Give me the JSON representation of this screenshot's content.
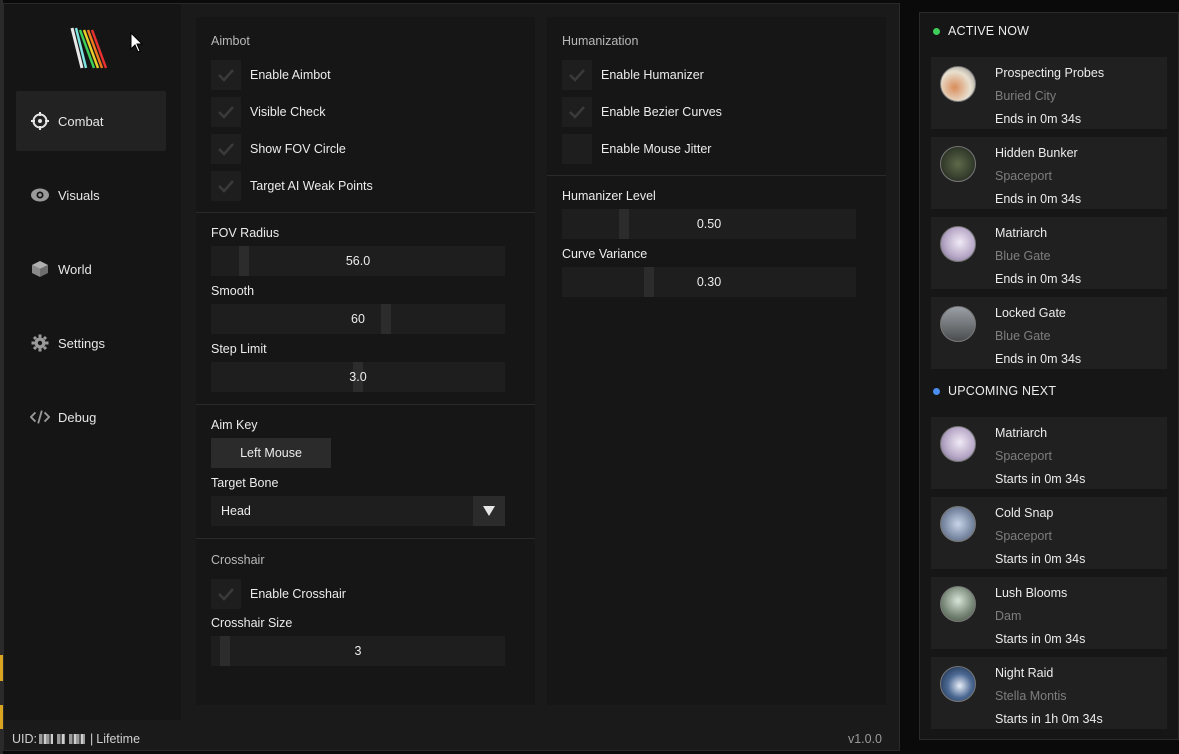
{
  "sidebar": {
    "items": [
      {
        "label": "Combat",
        "icon": "crosshair-icon",
        "active": true
      },
      {
        "label": "Visuals",
        "icon": "eye-icon",
        "active": false
      },
      {
        "label": "World",
        "icon": "cube-icon",
        "active": false
      },
      {
        "label": "Settings",
        "icon": "gear-icon",
        "active": false
      },
      {
        "label": "Debug",
        "icon": "code-icon",
        "active": false
      }
    ]
  },
  "aimbot": {
    "title": "Aimbot",
    "checks": [
      {
        "label": "Enable Aimbot",
        "checked": true
      },
      {
        "label": "Visible Check",
        "checked": true
      },
      {
        "label": "Show FOV Circle",
        "checked": true
      },
      {
        "label": "Target AI Weak Points",
        "checked": true
      }
    ],
    "sliders": [
      {
        "label": "FOV Radius",
        "value": "56.0",
        "level": 0.1
      },
      {
        "label": "Smooth",
        "value": "60",
        "level": 0.6
      },
      {
        "label": "Step Limit",
        "value": "3.0",
        "level": 0.5
      }
    ],
    "aim_key_label": "Aim Key",
    "aim_key_value": "Left Mouse",
    "target_bone_label": "Target Bone",
    "target_bone_value": "Head"
  },
  "crosshair": {
    "title": "Crosshair",
    "enable_label": "Enable Crosshair",
    "enabled": true,
    "size_label": "Crosshair Size",
    "size_value": "3",
    "size_level": 0.03
  },
  "humanization": {
    "title": "Humanization",
    "checks": [
      {
        "label": "Enable Humanizer",
        "checked": true
      },
      {
        "label": "Enable Bezier Curves",
        "checked": true
      },
      {
        "label": "Enable Mouse Jitter",
        "checked": false
      }
    ],
    "sliders": [
      {
        "label": "Humanizer Level",
        "value": "0.50",
        "level": 0.2
      },
      {
        "label": "Curve Variance",
        "value": "0.30",
        "level": 0.29
      }
    ]
  },
  "footer": {
    "uid_label": "UID:",
    "separator": "|",
    "license": "Lifetime",
    "version": "v1.0.0"
  },
  "events": {
    "active_title": "ACTIVE NOW",
    "active_color": "#3ecf5a",
    "upcoming_title": "UPCOMING NEXT",
    "upcoming_color": "#4a8ef0",
    "active": [
      {
        "title": "Prospecting Probes",
        "location": "Buried City",
        "time": "Ends in 0m 34s"
      },
      {
        "title": "Hidden Bunker",
        "location": "Spaceport",
        "time": "Ends in 0m 34s"
      },
      {
        "title": "Matriarch",
        "location": "Blue Gate",
        "time": "Ends in 0m 34s"
      },
      {
        "title": "Locked Gate",
        "location": "Blue Gate",
        "time": "Ends in 0m 34s"
      }
    ],
    "upcoming": [
      {
        "title": "Matriarch",
        "location": "Spaceport",
        "time": "Starts in 0m 34s"
      },
      {
        "title": "Cold Snap",
        "location": "Spaceport",
        "time": "Starts in 0m 34s"
      },
      {
        "title": "Lush Blooms",
        "location": "Dam",
        "time": "Starts in 0m 34s"
      },
      {
        "title": "Night Raid",
        "location": "Stella Montis",
        "time": "Starts in 1h 0m 34s"
      }
    ]
  }
}
